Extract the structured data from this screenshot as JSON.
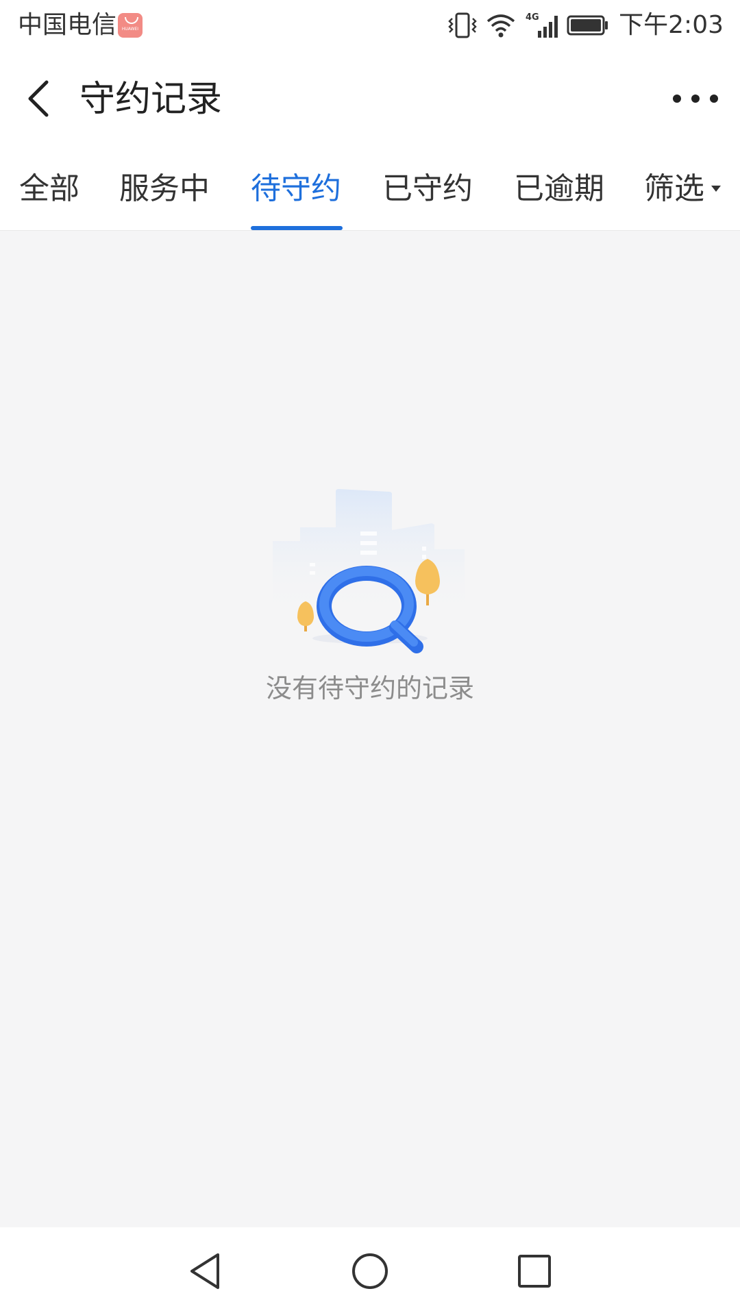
{
  "status_bar": {
    "carrier": "中国电信",
    "badge_text": "HUAWEI",
    "time": "下午2:03",
    "network": "4G"
  },
  "header": {
    "title": "守约记录"
  },
  "tabs": [
    {
      "label": "全部",
      "active": false
    },
    {
      "label": "服务中",
      "active": false
    },
    {
      "label": "待守约",
      "active": true
    },
    {
      "label": "已守约",
      "active": false
    },
    {
      "label": "已逾期",
      "active": false
    },
    {
      "label": "筛选",
      "active": false
    }
  ],
  "empty_state": {
    "message": "没有待守约的记录"
  },
  "colors": {
    "accent": "#1e6fdc",
    "background": "#f5f5f6",
    "text_primary": "#222222",
    "text_muted": "#8c8c8c"
  },
  "icons": {
    "back": "chevron-left-icon",
    "more": "more-horizontal-icon",
    "empty": "magnifier-city-illustration",
    "nav_back": "triangle-back-icon",
    "nav_home": "circle-home-icon",
    "nav_recents": "square-recents-icon"
  }
}
